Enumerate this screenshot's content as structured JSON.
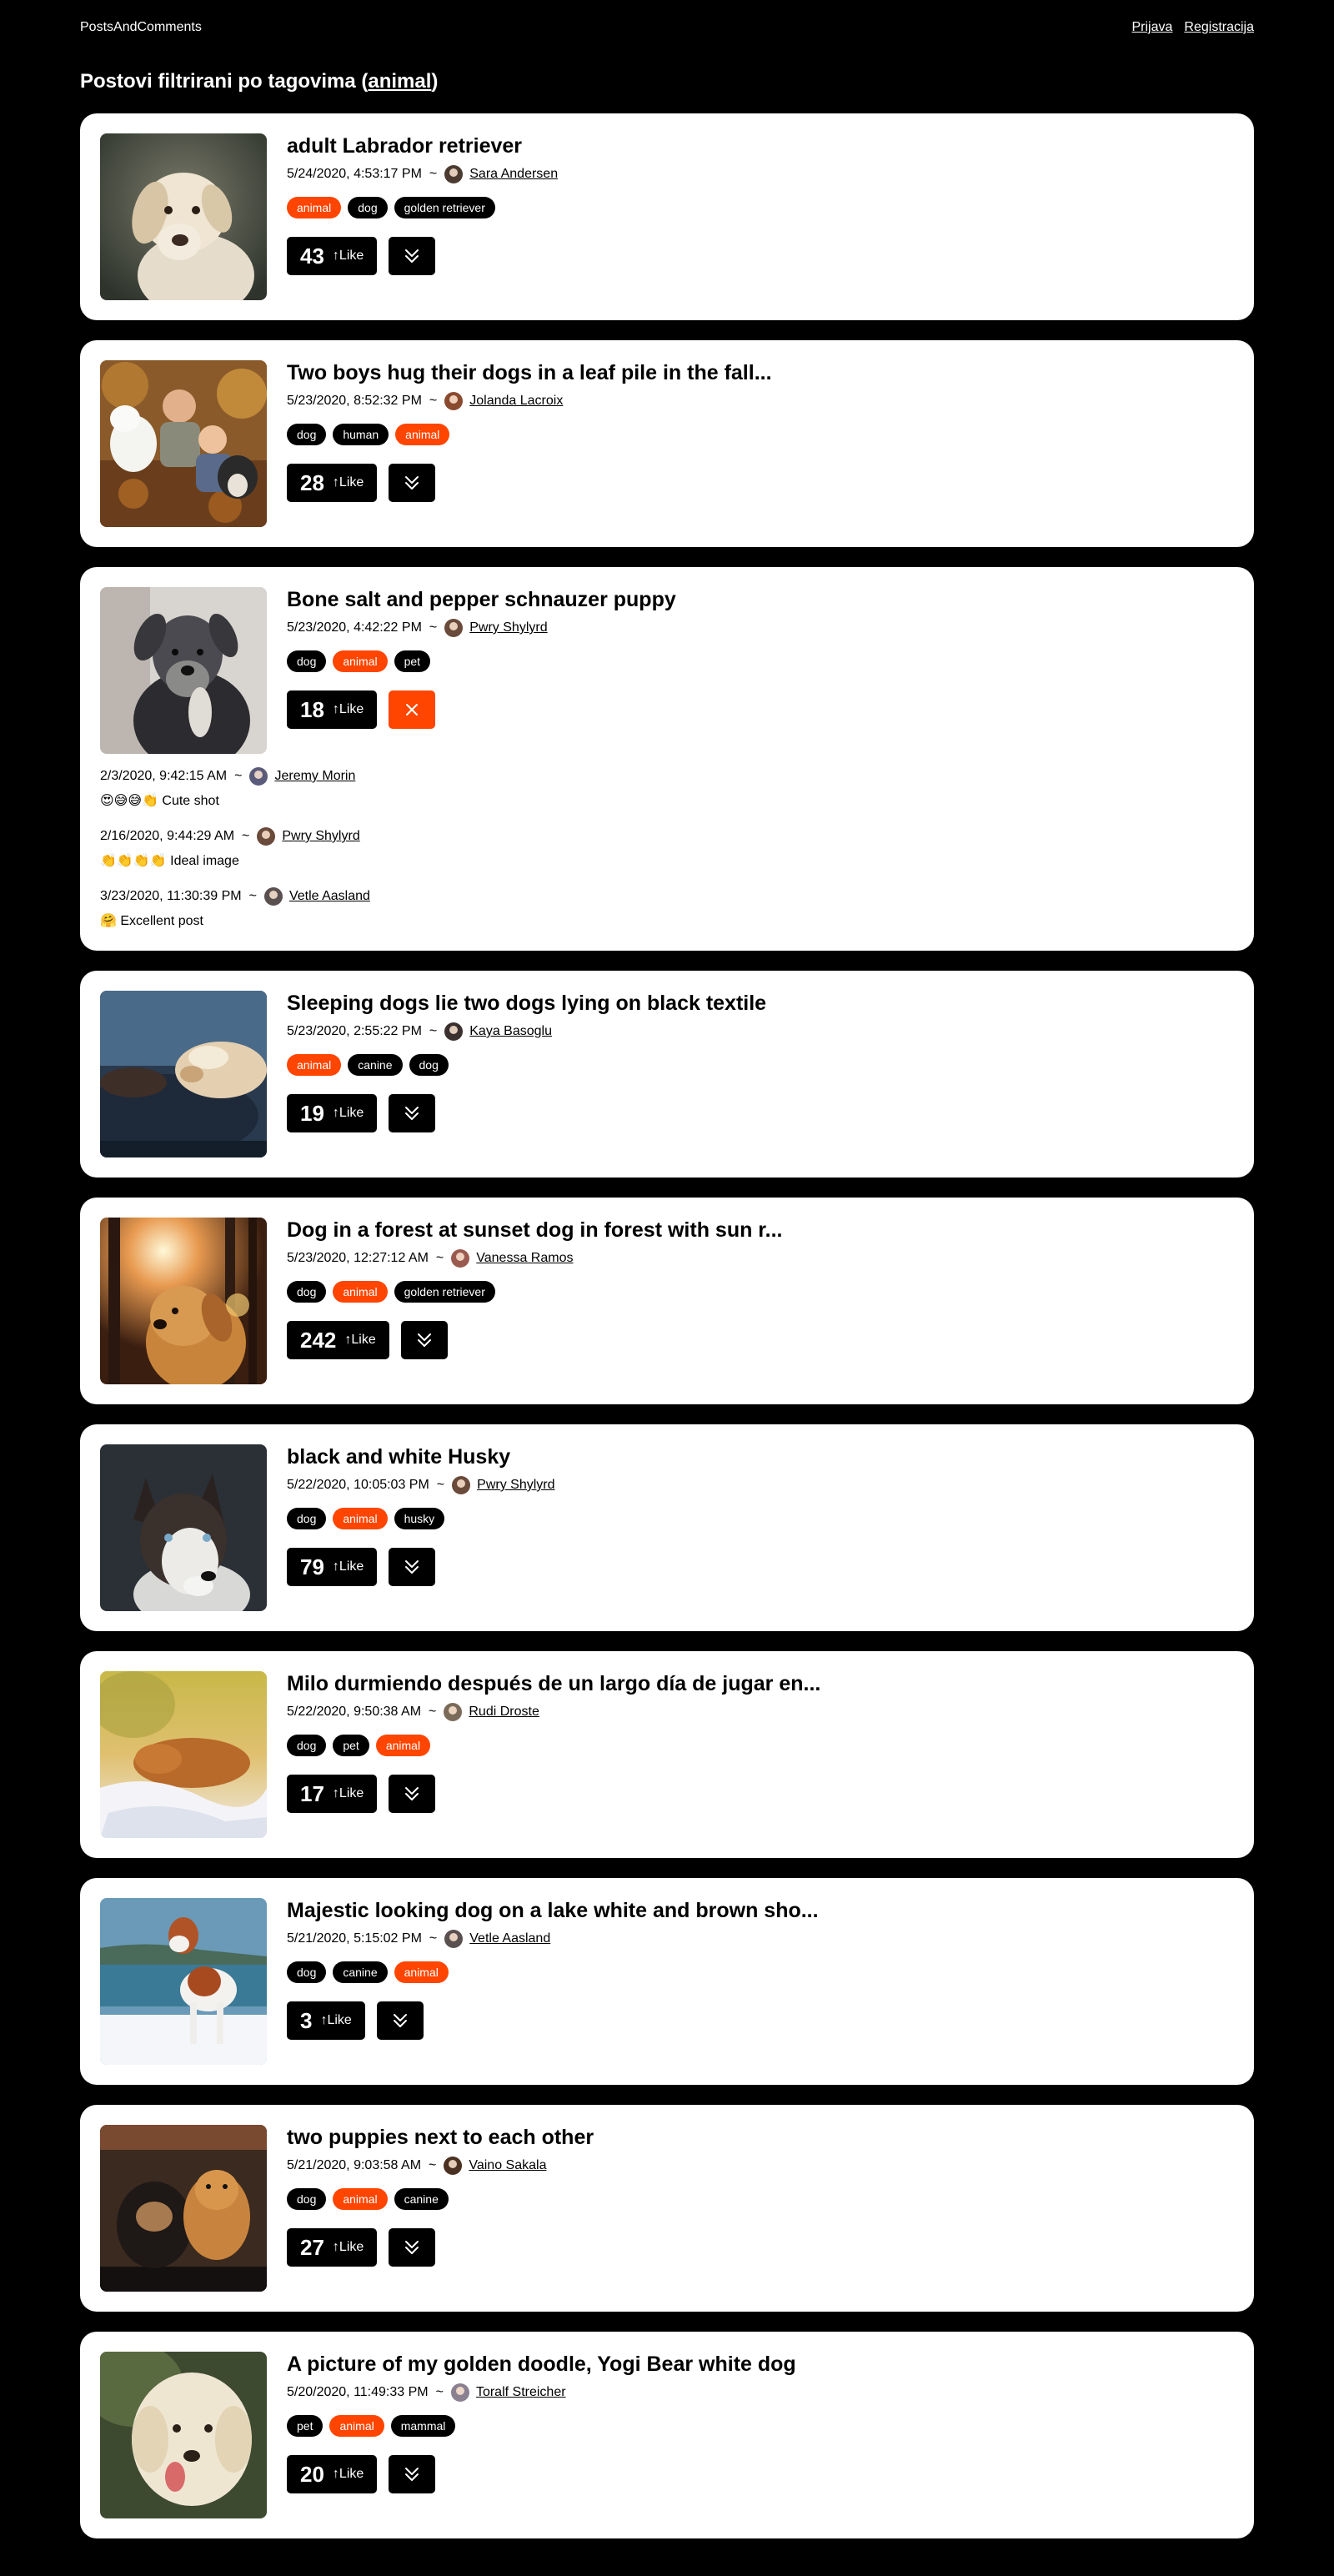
{
  "header": {
    "brand": "PostsAndComments",
    "login": "Prijava",
    "register": "Registracija"
  },
  "page": {
    "title_prefix": "Postovi filtrirani po tagovima (",
    "tag": "animal",
    "title_suffix": ")"
  },
  "like_label": "↑Like",
  "active_tag": "animal",
  "posts": [
    {
      "title": "adult Labrador retriever",
      "date": "5/24/2020, 4:53:17 PM",
      "author": "Sara Andersen",
      "tags": [
        "animal",
        "dog",
        "golden retriever"
      ],
      "likes": "43",
      "expanded": false,
      "image": "labrador",
      "avatar": "#4a3a30"
    },
    {
      "title": "Two boys hug their dogs in a leaf pile in the fall...",
      "date": "5/23/2020, 8:52:32 PM",
      "author": "Jolanda Lacroix",
      "tags": [
        "dog",
        "human",
        "animal"
      ],
      "likes": "28",
      "expanded": false,
      "image": "boys",
      "avatar": "#8a4a30"
    },
    {
      "title": "Bone salt and pepper schnauzer puppy",
      "date": "5/23/2020, 4:42:22 PM",
      "author": "Pwry Shylyrd",
      "tags": [
        "dog",
        "animal",
        "pet"
      ],
      "likes": "18",
      "expanded": true,
      "image": "schnauzer",
      "avatar": "#6a4a3a",
      "comments": [
        {
          "date": "2/3/2020, 9:42:15 AM",
          "author": "Jeremy Morin",
          "text": "😍😅😅👏 Cute shot",
          "avatar": "#5a5a7a"
        },
        {
          "date": "2/16/2020, 9:44:29 AM",
          "author": "Pwry Shylyrd",
          "text": "👏👏👏👏 Ideal image",
          "avatar": "#6a4a3a"
        },
        {
          "date": "3/23/2020, 11:30:39 PM",
          "author": "Vetle Aasland",
          "text": "🤗 Excellent post",
          "avatar": "#5a5050"
        }
      ]
    },
    {
      "title": "Sleeping dogs lie two dogs lying on black textile",
      "date": "5/23/2020, 2:55:22 PM",
      "author": "Kaya Basoglu",
      "tags": [
        "animal",
        "canine",
        "dog"
      ],
      "likes": "19",
      "expanded": false,
      "image": "sleeping",
      "avatar": "#3a3030"
    },
    {
      "title": "Dog in a forest at sunset dog in forest with sun r...",
      "date": "5/23/2020, 12:27:12 AM",
      "author": "Vanessa Ramos",
      "tags": [
        "dog",
        "animal",
        "golden retriever"
      ],
      "likes": "242",
      "expanded": false,
      "image": "forest",
      "avatar": "#9a5a50"
    },
    {
      "title": "black and white Husky",
      "date": "5/22/2020, 10:05:03 PM",
      "author": "Pwry Shylyrd",
      "tags": [
        "dog",
        "animal",
        "husky"
      ],
      "likes": "79",
      "expanded": false,
      "image": "husky",
      "avatar": "#6a4a3a"
    },
    {
      "title": "Milo durmiendo después de un largo día de jugar en...",
      "date": "5/22/2020, 9:50:38 AM",
      "author": "Rudi Droste",
      "tags": [
        "dog",
        "pet",
        "animal"
      ],
      "likes": "17",
      "expanded": false,
      "image": "milo",
      "avatar": "#7a6a5a"
    },
    {
      "title": "Majestic looking dog on a lake white and brown sho...",
      "date": "5/21/2020, 5:15:02 PM",
      "author": "Vetle Aasland",
      "tags": [
        "dog",
        "canine",
        "animal"
      ],
      "likes": "3",
      "expanded": false,
      "image": "lake",
      "avatar": "#5a5050"
    },
    {
      "title": "two puppies next to each other",
      "date": "5/21/2020, 9:03:58 AM",
      "author": "Vaino Sakala",
      "tags": [
        "dog",
        "animal",
        "canine"
      ],
      "likes": "27",
      "expanded": false,
      "image": "puppies",
      "avatar": "#4a3020"
    },
    {
      "title": "A picture of my golden doodle, Yogi Bear white dog",
      "date": "5/20/2020, 11:49:33 PM",
      "author": "Toralf Streicher",
      "tags": [
        "pet",
        "animal",
        "mammal"
      ],
      "likes": "20",
      "expanded": false,
      "image": "doodle",
      "avatar": "#8a8090"
    }
  ]
}
